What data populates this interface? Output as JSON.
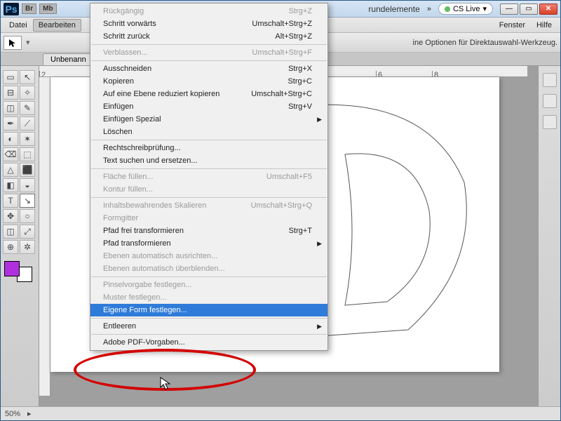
{
  "titlebar": {
    "partial": "rundelemente",
    "badges": [
      "Br",
      "Mb"
    ],
    "cslive": "CS Live"
  },
  "menubar": {
    "items": [
      "Datei",
      "Bearbeiten"
    ],
    "right_items": [
      "Fenster",
      "Hilfe"
    ],
    "active_index": 1
  },
  "optionsbar": {
    "text": "ine Optionen für Direktauswahl-Werkzeug."
  },
  "doctab": {
    "label": "Unbenann"
  },
  "statusbar": {
    "zoom": "50%"
  },
  "tool_icons": [
    "▭",
    "↖",
    "⊟",
    "✧",
    "◫",
    "✎",
    "✒",
    "⟋",
    "◐",
    "✶",
    "⌫",
    "⬚",
    "△",
    "⬛",
    "◧",
    "◒",
    "T",
    "↘",
    "✥",
    "○",
    "◫",
    "⤢",
    "⊕",
    "✲"
  ],
  "menu": {
    "sections": [
      [
        {
          "label": "Rückgängig",
          "shortcut": "Strg+Z",
          "dis": true
        },
        {
          "label": "Schritt vorwärts",
          "shortcut": "Umschalt+Strg+Z",
          "dis": false
        },
        {
          "label": "Schritt zurück",
          "shortcut": "Alt+Strg+Z",
          "dis": false
        }
      ],
      [
        {
          "label": "Verblassen...",
          "shortcut": "Umschalt+Strg+F",
          "dis": true
        }
      ],
      [
        {
          "label": "Ausschneiden",
          "shortcut": "Strg+X",
          "dis": false
        },
        {
          "label": "Kopieren",
          "shortcut": "Strg+C",
          "dis": false
        },
        {
          "label": "Auf eine Ebene reduziert kopieren",
          "shortcut": "Umschalt+Strg+C",
          "dis": false
        },
        {
          "label": "Einfügen",
          "shortcut": "Strg+V",
          "dis": false
        },
        {
          "label": "Einfügen Spezial",
          "shortcut": "",
          "dis": false,
          "sub": true
        },
        {
          "label": "Löschen",
          "shortcut": "",
          "dis": false
        }
      ],
      [
        {
          "label": "Rechtschreibprüfung...",
          "shortcut": "",
          "dis": false
        },
        {
          "label": "Text suchen und ersetzen...",
          "shortcut": "",
          "dis": false
        }
      ],
      [
        {
          "label": "Fläche füllen...",
          "shortcut": "Umschalt+F5",
          "dis": true
        },
        {
          "label": "Kontur füllen...",
          "shortcut": "",
          "dis": true
        }
      ],
      [
        {
          "label": "Inhaltsbewahrendes Skalieren",
          "shortcut": "Umschalt+Strg+Q",
          "dis": true
        },
        {
          "label": "Formgitter",
          "shortcut": "",
          "dis": true
        },
        {
          "label": "Pfad frei transformieren",
          "shortcut": "Strg+T",
          "dis": false
        },
        {
          "label": "Pfad transformieren",
          "shortcut": "",
          "dis": false,
          "sub": true
        },
        {
          "label": "Ebenen automatisch ausrichten...",
          "shortcut": "",
          "dis": true
        },
        {
          "label": "Ebenen automatisch überblenden...",
          "shortcut": "",
          "dis": true
        }
      ],
      [
        {
          "label": "Pinselvorgabe festlegen...",
          "shortcut": "",
          "dis": true
        },
        {
          "label": "Muster festlegen...",
          "shortcut": "",
          "dis": true
        },
        {
          "label": "Eigene Form festlegen...",
          "shortcut": "",
          "dis": false,
          "hl": true
        }
      ],
      [
        {
          "label": "Entleeren",
          "shortcut": "",
          "dis": false,
          "sub": true
        }
      ],
      [
        {
          "label": "Adobe PDF-Vorgaben...",
          "shortcut": "",
          "dis": false
        }
      ]
    ]
  }
}
